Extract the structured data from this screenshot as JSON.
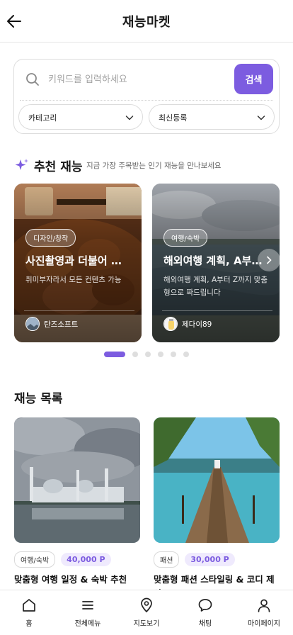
{
  "header": {
    "title": "재능마켓",
    "back_icon": "arrow-left-icon"
  },
  "search": {
    "placeholder": "키워드를 입력하세요",
    "button_label": "검색",
    "category_select": "카테고리",
    "sort_select": "최신등록"
  },
  "recommended": {
    "title": "추천 재능",
    "subtitle": "지금 가장 주목받는 인기 재능을 만나보세요",
    "cards": [
      {
        "category": "디자인/창작",
        "title": "사진촬영과 더불어 …",
        "description": "취미부자라서 모든 컨텐츠 가능",
        "author": "탄즈소프트"
      },
      {
        "category": "여행/숙박",
        "title": "해외여행 계획, A부…",
        "description": "해외여행 계획, A부터 Z까지 맞춤형으로 짜드립니다",
        "author": "제다이89"
      }
    ],
    "pagination": {
      "total": 6,
      "active": 1
    }
  },
  "talent_list": {
    "title": "재능 목록",
    "items": [
      {
        "category": "여행/숙박",
        "price": "40,000 P",
        "title": "맞춤형 여행 일정 & 숙박 추천"
      },
      {
        "category": "패션",
        "price": "30,000 P",
        "title": "맞춤형 패션 스타일링 & 코디 제안"
      }
    ]
  },
  "tabbar": {
    "items": [
      {
        "label": "홈",
        "icon": "home-icon"
      },
      {
        "label": "전체메뉴",
        "icon": "menu-icon"
      },
      {
        "label": "지도보기",
        "icon": "map-pin-icon"
      },
      {
        "label": "채팅",
        "icon": "chat-icon"
      },
      {
        "label": "마이페이지",
        "icon": "user-icon"
      }
    ]
  },
  "colors": {
    "accent": "#7c5ce0",
    "accent_light": "#efeafd"
  }
}
